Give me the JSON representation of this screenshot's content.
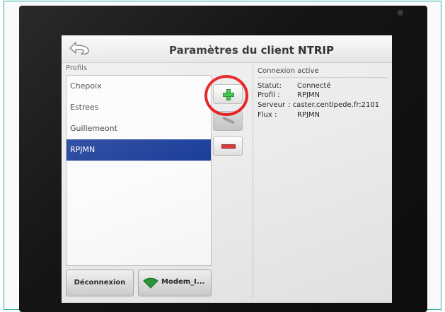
{
  "screen": {
    "title": "Paramètres du client NTRIP"
  },
  "profiles": {
    "label": "Profils",
    "items": [
      {
        "name": "Chepoix",
        "selected": false
      },
      {
        "name": "Estrees",
        "selected": false
      },
      {
        "name": "Guillemeont",
        "selected": false
      },
      {
        "name": "RPJMN",
        "selected": true
      }
    ]
  },
  "actions": {
    "add_icon": "plus-icon",
    "edit_icon": "edit-icon",
    "delete_icon": "minus-icon"
  },
  "connection": {
    "title": "Connexion active",
    "statut_label": "Statut:",
    "statut_value": "Connecté",
    "profil_label": "Profil :",
    "profil_value": "RPJMN",
    "serveur_label": "Serveur",
    "serveur_value": ": caster.centipede.fr:2101",
    "flux_label": "Flux :",
    "flux_value": "RPJMN"
  },
  "footer": {
    "disconnect_label": "Déconnexion",
    "modem_label": "Modem_I..."
  },
  "colors": {
    "selection": "#1c3f9a",
    "highlight_circle": "#e4161a",
    "add_green": "#3cc24a",
    "delete_red": "#d53b3b",
    "wifi_green": "#2a9a3a"
  }
}
